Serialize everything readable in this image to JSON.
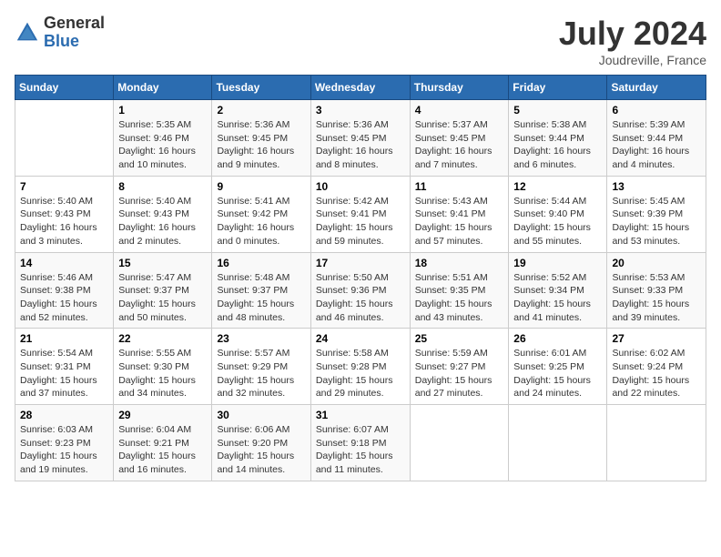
{
  "header": {
    "logo_general": "General",
    "logo_blue": "Blue",
    "title": "July 2024",
    "location": "Joudreville, France"
  },
  "days_of_week": [
    "Sunday",
    "Monday",
    "Tuesday",
    "Wednesday",
    "Thursday",
    "Friday",
    "Saturday"
  ],
  "weeks": [
    [
      {
        "day": "",
        "info": ""
      },
      {
        "day": "1",
        "info": "Sunrise: 5:35 AM\nSunset: 9:46 PM\nDaylight: 16 hours\nand 10 minutes."
      },
      {
        "day": "2",
        "info": "Sunrise: 5:36 AM\nSunset: 9:45 PM\nDaylight: 16 hours\nand 9 minutes."
      },
      {
        "day": "3",
        "info": "Sunrise: 5:36 AM\nSunset: 9:45 PM\nDaylight: 16 hours\nand 8 minutes."
      },
      {
        "day": "4",
        "info": "Sunrise: 5:37 AM\nSunset: 9:45 PM\nDaylight: 16 hours\nand 7 minutes."
      },
      {
        "day": "5",
        "info": "Sunrise: 5:38 AM\nSunset: 9:44 PM\nDaylight: 16 hours\nand 6 minutes."
      },
      {
        "day": "6",
        "info": "Sunrise: 5:39 AM\nSunset: 9:44 PM\nDaylight: 16 hours\nand 4 minutes."
      }
    ],
    [
      {
        "day": "7",
        "info": "Sunrise: 5:40 AM\nSunset: 9:43 PM\nDaylight: 16 hours\nand 3 minutes."
      },
      {
        "day": "8",
        "info": "Sunrise: 5:40 AM\nSunset: 9:43 PM\nDaylight: 16 hours\nand 2 minutes."
      },
      {
        "day": "9",
        "info": "Sunrise: 5:41 AM\nSunset: 9:42 PM\nDaylight: 16 hours\nand 0 minutes."
      },
      {
        "day": "10",
        "info": "Sunrise: 5:42 AM\nSunset: 9:41 PM\nDaylight: 15 hours\nand 59 minutes."
      },
      {
        "day": "11",
        "info": "Sunrise: 5:43 AM\nSunset: 9:41 PM\nDaylight: 15 hours\nand 57 minutes."
      },
      {
        "day": "12",
        "info": "Sunrise: 5:44 AM\nSunset: 9:40 PM\nDaylight: 15 hours\nand 55 minutes."
      },
      {
        "day": "13",
        "info": "Sunrise: 5:45 AM\nSunset: 9:39 PM\nDaylight: 15 hours\nand 53 minutes."
      }
    ],
    [
      {
        "day": "14",
        "info": "Sunrise: 5:46 AM\nSunset: 9:38 PM\nDaylight: 15 hours\nand 52 minutes."
      },
      {
        "day": "15",
        "info": "Sunrise: 5:47 AM\nSunset: 9:37 PM\nDaylight: 15 hours\nand 50 minutes."
      },
      {
        "day": "16",
        "info": "Sunrise: 5:48 AM\nSunset: 9:37 PM\nDaylight: 15 hours\nand 48 minutes."
      },
      {
        "day": "17",
        "info": "Sunrise: 5:50 AM\nSunset: 9:36 PM\nDaylight: 15 hours\nand 46 minutes."
      },
      {
        "day": "18",
        "info": "Sunrise: 5:51 AM\nSunset: 9:35 PM\nDaylight: 15 hours\nand 43 minutes."
      },
      {
        "day": "19",
        "info": "Sunrise: 5:52 AM\nSunset: 9:34 PM\nDaylight: 15 hours\nand 41 minutes."
      },
      {
        "day": "20",
        "info": "Sunrise: 5:53 AM\nSunset: 9:33 PM\nDaylight: 15 hours\nand 39 minutes."
      }
    ],
    [
      {
        "day": "21",
        "info": "Sunrise: 5:54 AM\nSunset: 9:31 PM\nDaylight: 15 hours\nand 37 minutes."
      },
      {
        "day": "22",
        "info": "Sunrise: 5:55 AM\nSunset: 9:30 PM\nDaylight: 15 hours\nand 34 minutes."
      },
      {
        "day": "23",
        "info": "Sunrise: 5:57 AM\nSunset: 9:29 PM\nDaylight: 15 hours\nand 32 minutes."
      },
      {
        "day": "24",
        "info": "Sunrise: 5:58 AM\nSunset: 9:28 PM\nDaylight: 15 hours\nand 29 minutes."
      },
      {
        "day": "25",
        "info": "Sunrise: 5:59 AM\nSunset: 9:27 PM\nDaylight: 15 hours\nand 27 minutes."
      },
      {
        "day": "26",
        "info": "Sunrise: 6:01 AM\nSunset: 9:25 PM\nDaylight: 15 hours\nand 24 minutes."
      },
      {
        "day": "27",
        "info": "Sunrise: 6:02 AM\nSunset: 9:24 PM\nDaylight: 15 hours\nand 22 minutes."
      }
    ],
    [
      {
        "day": "28",
        "info": "Sunrise: 6:03 AM\nSunset: 9:23 PM\nDaylight: 15 hours\nand 19 minutes."
      },
      {
        "day": "29",
        "info": "Sunrise: 6:04 AM\nSunset: 9:21 PM\nDaylight: 15 hours\nand 16 minutes."
      },
      {
        "day": "30",
        "info": "Sunrise: 6:06 AM\nSunset: 9:20 PM\nDaylight: 15 hours\nand 14 minutes."
      },
      {
        "day": "31",
        "info": "Sunrise: 6:07 AM\nSunset: 9:18 PM\nDaylight: 15 hours\nand 11 minutes."
      },
      {
        "day": "",
        "info": ""
      },
      {
        "day": "",
        "info": ""
      },
      {
        "day": "",
        "info": ""
      }
    ]
  ]
}
